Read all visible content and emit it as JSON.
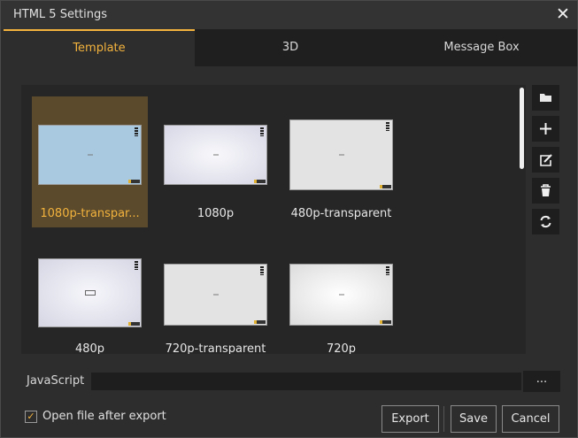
{
  "window": {
    "title": "HTML 5 Settings",
    "close_glyph": "✕"
  },
  "tabs": [
    {
      "label": "Template",
      "active": true
    },
    {
      "label": "3D",
      "active": false
    },
    {
      "label": "Message Box",
      "active": false
    }
  ],
  "templates": [
    {
      "label": "1080p-transpar...",
      "selected": true,
      "thumb_color": "#a9c9e0"
    },
    {
      "label": "1080p",
      "selected": false,
      "thumb_color": "#e0e0ee"
    },
    {
      "label": "480p-transparent",
      "selected": false,
      "thumb_color": "#e3e3e3"
    },
    {
      "label": "480p",
      "selected": false,
      "thumb_color": "#e4e4ee"
    },
    {
      "label": "720p-transparent",
      "selected": false,
      "thumb_color": "#e3e3e3"
    },
    {
      "label": "720p",
      "selected": false,
      "thumb_color": "#efefef"
    }
  ],
  "side_tools": [
    {
      "icon": "folder-icon"
    },
    {
      "icon": "add-icon"
    },
    {
      "icon": "edit-icon"
    },
    {
      "icon": "delete-icon"
    },
    {
      "icon": "refresh-icon"
    }
  ],
  "javascript": {
    "label": "JavaScript",
    "value": "",
    "browse_label": "..."
  },
  "options": {
    "open_after_export_label": "Open file after export",
    "open_after_export": true,
    "check_glyph": "✓"
  },
  "buttons": {
    "export": "Export",
    "save": "Save",
    "cancel": "Cancel"
  },
  "colors": {
    "accent": "#f3b33d",
    "selected_tile": "#5b4a2c"
  }
}
